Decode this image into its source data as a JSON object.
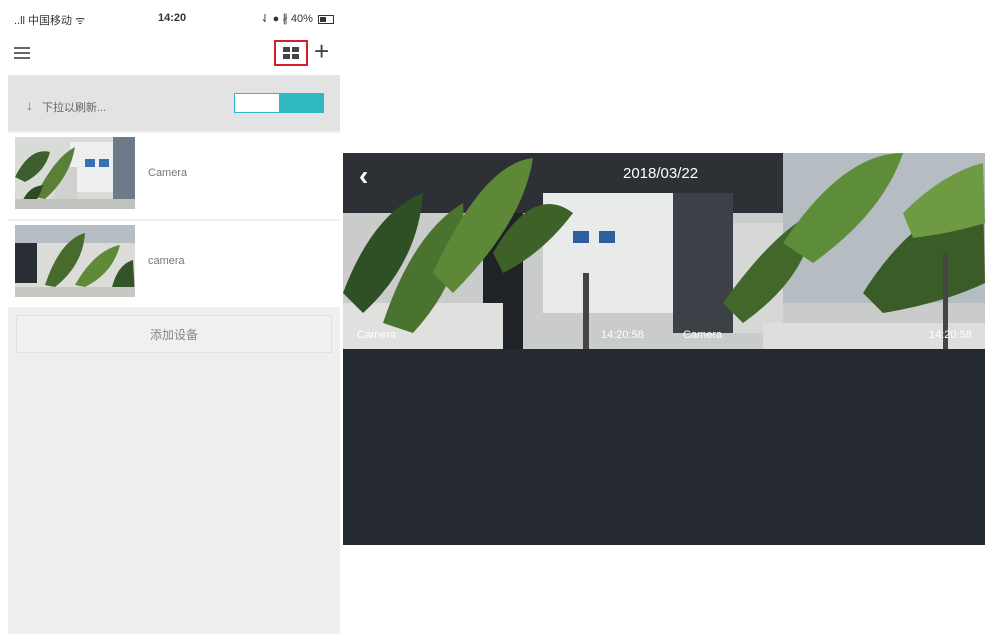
{
  "status_bar": {
    "carrier": "..ll 中国移动 ᯤ",
    "time": "14:20",
    "right": "⇃ ● ∦ 40%"
  },
  "nav": {
    "menu_icon": "hamburger-menu-icon",
    "layout_icon": "grid-view-icon",
    "add_icon": "plus-icon",
    "add_symbol": "+"
  },
  "list": {
    "pull_to_refresh": "下拉以刷新...",
    "pull_arrow": "↓",
    "cameras": [
      {
        "name": "Camera"
      },
      {
        "name": "camera"
      }
    ],
    "add_device": "添加设备"
  },
  "player": {
    "back_symbol": "‹",
    "date": "2018/03/22",
    "feeds": [
      {
        "name": "Camera",
        "time": "14:20:58"
      },
      {
        "name": "Camera",
        "time": "14:20:58"
      }
    ]
  },
  "colors": {
    "highlight_box": "#d41f2a",
    "accent_teal": "#2fb8c2",
    "player_bg": "#252a31"
  }
}
